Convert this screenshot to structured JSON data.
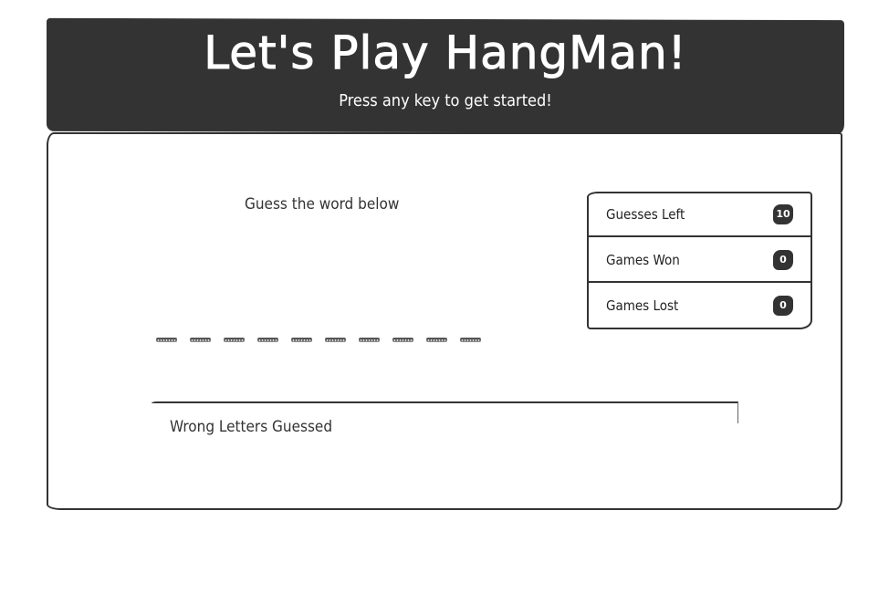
{
  "header": {
    "title": "Let's Play HangMan!",
    "subtitle": "Press any key to get started!"
  },
  "game": {
    "prompt": "Guess the word below",
    "word_length": 10,
    "wrong_letters_label": "Wrong Letters Guessed",
    "wrong_letters": ""
  },
  "stats": {
    "guesses_left": {
      "label": "Guesses Left",
      "value": "10"
    },
    "games_won": {
      "label": "Games Won",
      "value": "0"
    },
    "games_lost": {
      "label": "Games Lost",
      "value": "0"
    }
  },
  "colors": {
    "dark": "#333333",
    "background": "#ffffff"
  }
}
